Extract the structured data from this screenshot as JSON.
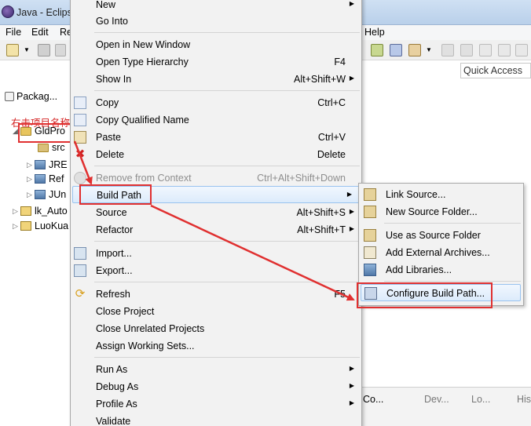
{
  "window": {
    "title": "Java - Eclips"
  },
  "menubar": {
    "items": [
      "File",
      "Edit",
      "Re",
      "Help"
    ]
  },
  "toolbar": {
    "quick_access": "Quick Access"
  },
  "package_explorer": {
    "tab_label": "Packag...",
    "annotation": "右击项目名称",
    "tree": [
      {
        "label": "GldPro",
        "expanded": true,
        "kind": "project"
      },
      {
        "label": "src",
        "kind": "folder"
      },
      {
        "label": "JRE",
        "kind": "library"
      },
      {
        "label": "Ref",
        "kind": "library"
      },
      {
        "label": "JUn",
        "kind": "library"
      },
      {
        "label": "lk_Auto",
        "kind": "project"
      },
      {
        "label": "LuoKua",
        "kind": "project"
      }
    ]
  },
  "context_menu": {
    "new": {
      "label": "New"
    },
    "go_into": {
      "label": "Go Into"
    },
    "open_new_window": {
      "label": "Open in New Window"
    },
    "open_type_hierarchy": {
      "label": "Open Type Hierarchy",
      "shortcut": "F4"
    },
    "show_in": {
      "label": "Show In",
      "shortcut": "Alt+Shift+W"
    },
    "copy": {
      "label": "Copy",
      "shortcut": "Ctrl+C"
    },
    "copy_qualified": {
      "label": "Copy Qualified Name"
    },
    "paste": {
      "label": "Paste",
      "shortcut": "Ctrl+V"
    },
    "delete": {
      "label": "Delete",
      "shortcut": "Delete"
    },
    "remove_context": {
      "label": "Remove from Context",
      "shortcut": "Ctrl+Alt+Shift+Down"
    },
    "build_path": {
      "label": "Build Path"
    },
    "source": {
      "label": "Source",
      "shortcut": "Alt+Shift+S"
    },
    "refactor": {
      "label": "Refactor",
      "shortcut": "Alt+Shift+T"
    },
    "import": {
      "label": "Import..."
    },
    "export": {
      "label": "Export..."
    },
    "refresh": {
      "label": "Refresh",
      "shortcut": "F5"
    },
    "close_project": {
      "label": "Close Project"
    },
    "close_unrelated": {
      "label": "Close Unrelated Projects"
    },
    "assign_working_sets": {
      "label": "Assign Working Sets..."
    },
    "run_as": {
      "label": "Run As"
    },
    "debug_as": {
      "label": "Debug As"
    },
    "profile_as": {
      "label": "Profile As"
    },
    "validate": {
      "label": "Validate"
    }
  },
  "build_path_submenu": {
    "link_source": "Link Source...",
    "new_source_folder": "New Source Folder...",
    "use_as_source": "Use as Source Folder",
    "add_external_archives": "Add External Archives...",
    "add_libraries": "Add Libraries...",
    "configure_build_path": "Configure Build Path..."
  },
  "bottom_tabs": [
    "Co...",
    "Dev...",
    "Lo...",
    "His"
  ],
  "colors": {
    "annotation_red": "#e03030",
    "highlight_border": "#99c3ef",
    "menu_bg": "#f2f2f2"
  }
}
